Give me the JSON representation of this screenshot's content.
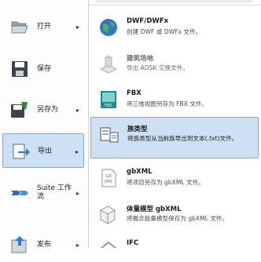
{
  "left_menu": [
    {
      "label": "打开",
      "arrow": "▸",
      "icon": "folder-open-icon"
    },
    {
      "label": "保存",
      "arrow": "",
      "icon": "save-icon"
    },
    {
      "label": "另存为",
      "arrow": "▸",
      "icon": "save-as-icon"
    },
    {
      "label": "导出",
      "arrow": "▸",
      "icon": "export-icon"
    },
    {
      "label": "Suite 工作流",
      "arrow": "▸",
      "icon": "suite-workflow-icon"
    },
    {
      "label": "发布",
      "arrow": "▸",
      "icon": "publish-icon"
    }
  ],
  "export_items": [
    {
      "title": "DWF/DWFx",
      "desc": "创建 DWF 或 DWFx 文件。",
      "icon": "dwf-globe-icon"
    },
    {
      "title": "建筑场地",
      "desc": "导出 ADSK 交换文件。",
      "icon": "building-site-icon"
    },
    {
      "title": "FBX",
      "desc": "将三维视图另存为 FBX 文件。",
      "icon": "fbx-icon"
    },
    {
      "title": "族类型",
      "desc": "将族类型从当前族导出到文本(.txt)文件。",
      "icon": "family-types-icon"
    },
    {
      "title": "gbXML",
      "desc": "将项目另存为 gbXML 文件。",
      "icon": "gbxml-icon"
    },
    {
      "title": "体量模型 gbXML",
      "desc": "将概念能量模型保存为 gbXML 文件。",
      "icon": "mass-gbxml-icon"
    },
    {
      "title": "IFC",
      "desc": "",
      "icon": "ifc-icon"
    }
  ],
  "colors": {
    "highlight": "#cde0f4",
    "highlight_border": "#7fa8d6",
    "accent_blue": "#2b6cb0"
  }
}
